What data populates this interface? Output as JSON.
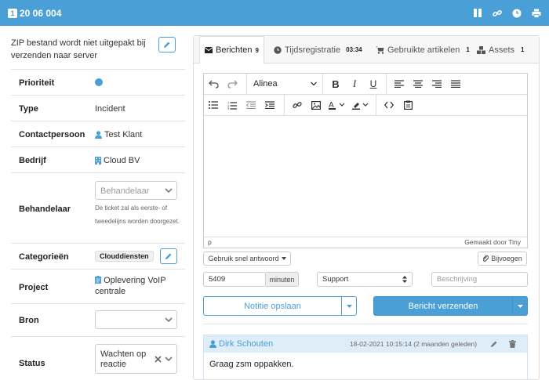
{
  "header": {
    "badge": "1",
    "ticket_no": "20 06 004",
    "colors": {
      "bar": "#4a9fd6"
    }
  },
  "left": {
    "description": "ZIP bestand wordt niet uitgepakt bij verzenden naar server",
    "properties": {
      "prioriteit": {
        "label": "Prioriteit"
      },
      "type": {
        "label": "Type",
        "value": "Incident"
      },
      "contactpersoon": {
        "label": "Contactpersoon",
        "value": "Test Klant"
      },
      "bedrijf": {
        "label": "Bedrijf",
        "value": "Cloud BV"
      },
      "behandelaar": {
        "label": "Behandelaar",
        "placeholder": "Behandelaar",
        "hint": "De ticket zal als eerste- of tweedelijns worden doorgezet."
      },
      "categorieen": {
        "label": "Categorieën",
        "tag": "Clouddiensten"
      },
      "project": {
        "label": "Project",
        "value": "Oplevering VoIP centrale"
      },
      "bron": {
        "label": "Bron",
        "value": ""
      },
      "status": {
        "label": "Status",
        "value": "Wachten op reactie"
      }
    }
  },
  "tabs": [
    {
      "label": "Berichten",
      "count": "9"
    },
    {
      "label": "Tijdsregistratie",
      "count": "03:34"
    },
    {
      "label": "Gebruikte artikelen",
      "count": "1"
    },
    {
      "label": "Assets",
      "count": "1"
    }
  ],
  "editor": {
    "format": "Alinea",
    "path": "p",
    "powered_by": "Gemaakt door Tiny"
  },
  "actions": {
    "quick_reply": "Gebruik snel antwoord",
    "attach": "Bijvoegen",
    "minutes_value": "5409",
    "minutes_unit": "minuten",
    "type_select": "Support",
    "description_placeholder": "Beschrijving",
    "save_note": "Notitie opslaan",
    "send": "Bericht verzenden"
  },
  "message": {
    "author": "Dirk Schouten",
    "date": "18-02-2021 10:15:14 (2 maanden geleden)",
    "body": "Graag zsm oppakken."
  }
}
